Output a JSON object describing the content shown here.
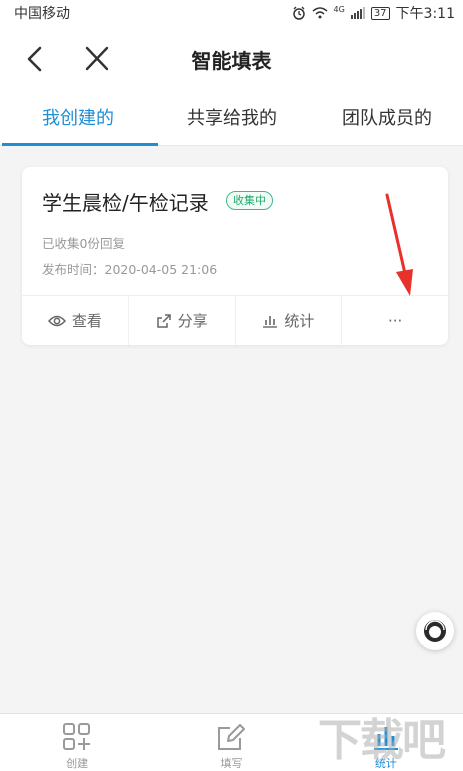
{
  "status_bar": {
    "carrier": "中国移动",
    "network": "4G",
    "battery": "37",
    "time": "下午3:11"
  },
  "header": {
    "title": "智能填表"
  },
  "tabs": [
    {
      "label": "我创建的",
      "active": true
    },
    {
      "label": "共享给我的",
      "active": false
    },
    {
      "label": "团队成员的",
      "active": false
    }
  ],
  "form_card": {
    "title": "学生晨检/午检记录",
    "status_badge": "收集中",
    "responses": "已收集0份回复",
    "published": "发布时间：2020-04-05 21:06",
    "actions": {
      "view": "查看",
      "share": "分享",
      "stats": "统计",
      "more": "···"
    }
  },
  "bottom_nav": [
    {
      "label": "创建",
      "icon": "create-grid-icon",
      "active": false
    },
    {
      "label": "填写",
      "icon": "edit-icon",
      "active": false
    },
    {
      "label": "统计",
      "icon": "bar-chart-icon",
      "active": true
    }
  ],
  "watermark": "下载吧",
  "colors": {
    "accent": "#1e8fd6",
    "badge": "#1faa6d",
    "annotation_arrow": "#e8312a"
  }
}
